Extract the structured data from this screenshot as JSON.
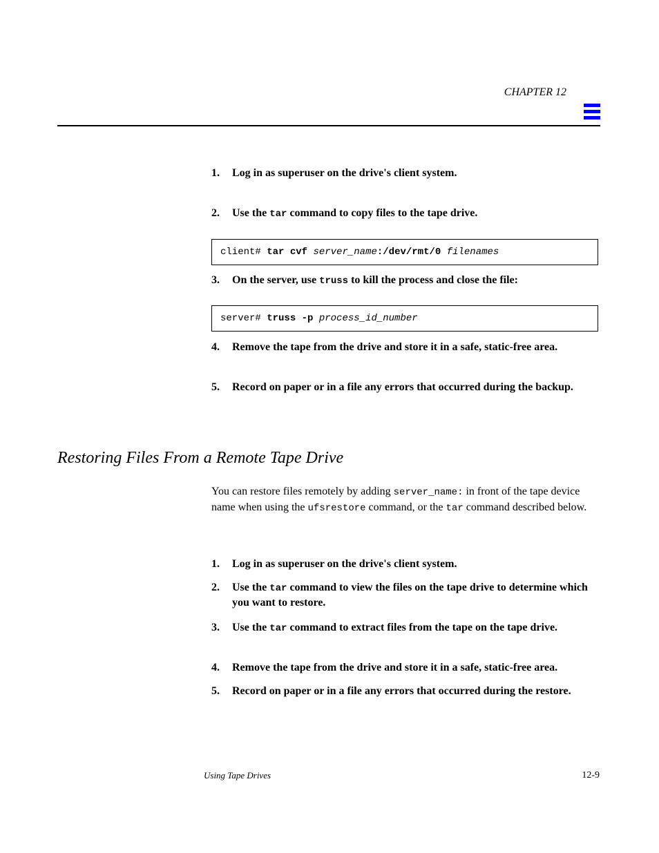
{
  "header": {
    "chapter": "CHAPTER 12"
  },
  "steps_top": {
    "s1_num": "1.",
    "s1_text": "Log in as superuser on the drive's client system.",
    "s2_num": "2.",
    "s2_text_a": "Use the ",
    "s2_code": "tar",
    "s2_text_b": " command to copy files to the tape drive.",
    "cmd1": "client# tar cvf server_name:/dev/rmt/0 filenames",
    "s3_num": "3.",
    "s3_text_a": "On the server, use ",
    "s3_code": "truss",
    "s3_text_b": " to kill the process and close the file:",
    "cmd2": "server# truss -p process_id_number",
    "s4_num": "4.",
    "s4_text": "Remove the tape from the drive and store it in a safe, static-free area.",
    "s5_num": "5.",
    "s5_text": "Record on paper or in a file any errors that occurred during the backup."
  },
  "section": {
    "title": "Restoring Files From a Remote Tape Drive"
  },
  "restore_para": {
    "a": "You can restore files remotely by adding ",
    "code1": "server_name:",
    "b": " in front of the tape device name when using the ",
    "code2": "ufsrestore",
    "c": " command, or the ",
    "code3": "tar",
    "d": " command described below."
  },
  "steps_restore": {
    "r1_num": "1.",
    "r1_text": "Log in as superuser on the drive's client system.",
    "r2_num": "2.",
    "r2_text_a": "Use the ",
    "r2_code": "tar",
    "r2_text_b": " command to view the files on the tape drive to determine which you want to restore.",
    "r3_num": "3.",
    "r3_text_a": "Use the ",
    "r3_code": "tar",
    "r3_text_b": " command to extract files from the tape on the tape drive.",
    "r4_num": "4.",
    "r4_text": "Remove the tape from the drive and store it in a safe, static-free area.",
    "r5_num": "5.",
    "r5_text": "Record on paper or in a file any errors that occurred during the restore."
  },
  "footer": {
    "left": "Using Tape Drives",
    "right": "12-9"
  }
}
